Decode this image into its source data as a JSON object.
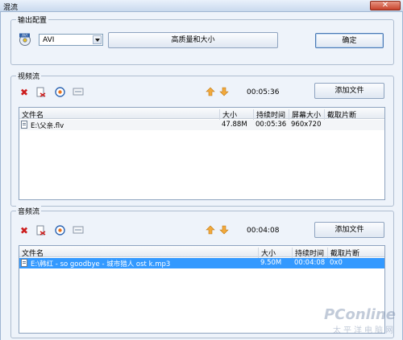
{
  "window": {
    "title": "混流",
    "close_glyph": "✕"
  },
  "output": {
    "group_label": "输出配置",
    "format_value": "AVI",
    "quality_button": "高质量和大小",
    "ok_button": "确定"
  },
  "video": {
    "group_label": "视频流",
    "duration": "00:05:36",
    "add_button": "添加文件",
    "columns": [
      "文件名",
      "大小",
      "持续时间",
      "屏幕大小",
      "截取片断"
    ],
    "rows": [
      {
        "name": "E:\\父亲.flv",
        "size": "47.88M",
        "duration": "00:05:36",
        "screen": "960x720",
        "clip": ""
      }
    ]
  },
  "audio": {
    "group_label": "音频流",
    "duration": "00:04:08",
    "add_button": "添加文件",
    "columns": [
      "文件名",
      "大小",
      "持续时间",
      "截取片断"
    ],
    "rows": [
      {
        "name": "E:\\韩红 - so goodbye - 城市猎人 ost k.mp3",
        "size": "9.50M",
        "duration": "00:04:08",
        "clip": "0x0"
      }
    ]
  },
  "icons": {
    "delete": "delete-icon",
    "clear": "clear-icon",
    "preview": "preview-icon",
    "settings": "settings-icon",
    "up": "arrow-up-icon",
    "down": "arrow-down-icon"
  },
  "watermark": {
    "brand": "PConline",
    "sub": "太平洋电脑网"
  },
  "colors": {
    "selection": "#3399ff",
    "delete": "#cc1d1d",
    "arrow": "#f2a93b"
  }
}
